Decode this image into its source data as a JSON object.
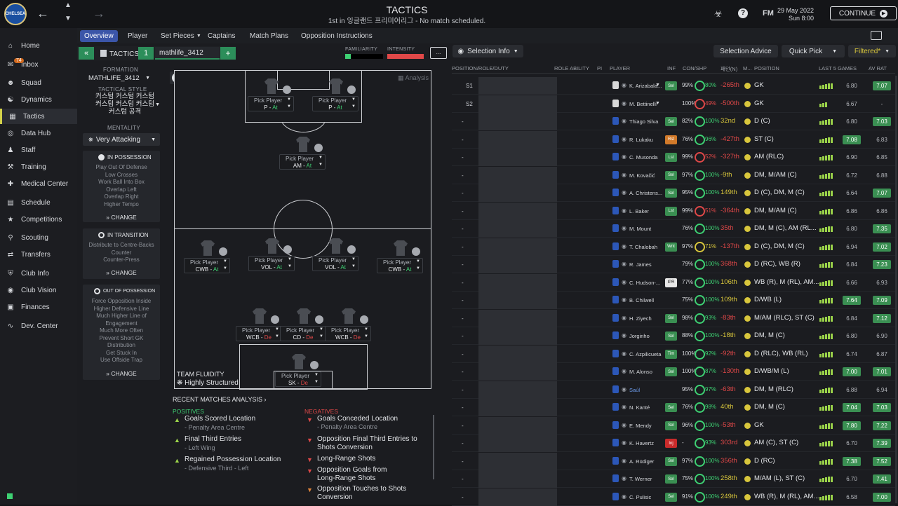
{
  "header": {
    "club_crest": "CHELSEA",
    "title": "TACTICS",
    "subtitle": "1st in 잉글랜드 프리미어리그 - No match scheduled.",
    "date_line1": "29 May 2022",
    "date_line2": "Sun 8:00",
    "continue_label": "CONTINUE",
    "fm_label": "FM"
  },
  "sidebar": {
    "inbox_badge": "74",
    "items": [
      "Home",
      "Inbox",
      "Squad",
      "Dynamics",
      "Tactics",
      "Data Hub",
      "Staff",
      "Training",
      "Medical Center",
      "Schedule",
      "Competitions",
      "Scouting",
      "Transfers",
      "Club Info",
      "Club Vision",
      "Finances",
      "Dev. Center"
    ]
  },
  "subnav": [
    "Overview",
    "Player",
    "Set Pieces",
    "Captains",
    "Match Plans",
    "Opposition Instructions"
  ],
  "tactics": {
    "panel_label": "TACTICS",
    "slot_number": "1",
    "tactic_name": "mathlife_3412",
    "familiarity_label": "FAMILIARITY",
    "intensity_label": "INTENSITY",
    "formation_label": "FORMATION",
    "formation_value": "MATHLIFE_3412",
    "style_label": "TACTICAL STYLE",
    "style_value": [
      "커스텀 커스텀 커스텀",
      "커스텀 커스텀 커스텀",
      "커스텀 공격"
    ],
    "mentality_label": "MENTALITY",
    "mentality_value": "Very Attacking",
    "in_possession": {
      "title": "IN POSSESSION",
      "lines": [
        "Play Out Of Defense",
        "Low Crosses",
        "Work Ball Into Box",
        "Overlap Left",
        "Overlap Right",
        "Higher Tempo"
      ],
      "change": "CHANGE"
    },
    "in_transition": {
      "title": "IN TRANSITION",
      "lines": [
        "Distribute to Centre-Backs",
        "Counter",
        "Counter-Press"
      ],
      "change": "CHANGE"
    },
    "out_of_possession": {
      "title": "OUT OF POSSESSION",
      "lines": [
        "Force Opposition Inside",
        "Higher Defensive Line",
        "Much Higher Line of",
        "Engagement",
        "Much More Often",
        "Prevent Short GK",
        "Distribution",
        "Get Stuck In",
        "Use Offside Trap"
      ],
      "change": "CHANGE"
    },
    "analysis_label": "Analysis",
    "fluidity_label": "TEAM FLUIDITY",
    "fluidity_value": "Highly Structured",
    "pitch_tiles": [
      {
        "label": "Pick Player",
        "role": "P",
        "duty": "At"
      },
      {
        "label": "Pick Player",
        "role": "P",
        "duty": "At"
      },
      {
        "label": "Pick Player",
        "role": "AM",
        "duty": "At"
      },
      {
        "label": "Pick Player",
        "role": "CWB",
        "duty": "At"
      },
      {
        "label": "Pick Player",
        "role": "VOL",
        "duty": "At"
      },
      {
        "label": "Pick Player",
        "role": "VOL",
        "duty": "At"
      },
      {
        "label": "Pick Player",
        "role": "CWB",
        "duty": "At"
      },
      {
        "label": "Pick Player",
        "role": "WCB",
        "duty": "De"
      },
      {
        "label": "Pick Player",
        "role": "CD",
        "duty": "De"
      },
      {
        "label": "Pick Player",
        "role": "WCB",
        "duty": "De"
      },
      {
        "label": "Pick Player",
        "role": "SK",
        "duty": "De"
      }
    ]
  },
  "analysis": {
    "title": "RECENT MATCHES ANALYSIS",
    "positives_label": "POSITIVES",
    "negatives_label": "NEGATIVES",
    "positives": [
      {
        "main": "Goals Scored Location",
        "sub": "- Penalty Area Centre"
      },
      {
        "main": "Final Third Entries",
        "sub": "- Left Wing"
      },
      {
        "main": "Regained Possession Location",
        "sub": "- Defensive Third - Left"
      }
    ],
    "negatives": [
      {
        "main": "Goals Conceded Location",
        "sub": "- Penalty Area Centre"
      },
      {
        "main": "Opposition Final Third Entries to",
        "sub": "Shots Conversion"
      },
      {
        "main": "Long-Range Shots",
        "sub": ""
      },
      {
        "main": "Opposition Goals from",
        "sub": "Long-Range Shots"
      },
      {
        "main": "Opposition Touches to Shots",
        "sub": "Conversion"
      }
    ]
  },
  "table": {
    "selection_info": "Selection Info",
    "selection_advice": "Selection Advice",
    "quick_pick": "Quick Pick",
    "filtered": "Filtered*",
    "headers": [
      "POSITION/ROLE/DUTY",
      "ROLE ABILITY",
      "PI",
      "PLAYER",
      "INF",
      "CON/SHP",
      "패턴(N)",
      "M...",
      "POSITION",
      "LAST 5 GAMES",
      "AV RAT"
    ],
    "rows": [
      {
        "slot": "S1",
        "name": "K. Arizabala...",
        "inf": "Sel",
        "con": "99%",
        "shp": "80%",
        "shp_color": "#3ed173",
        "rep": "-265th",
        "rep_color": "#e04848",
        "pos": "GK",
        "form": [
          3,
          4,
          5,
          6,
          6
        ],
        "last": "6.80",
        "av": "7.07",
        "avgreen": true
      },
      {
        "slot": "S2",
        "name": "M. Bettinelli",
        "inf": "",
        "con": "100%",
        "shp": "49%",
        "shp_color": "#e04848",
        "rep": "-500th",
        "rep_color": "#e04848",
        "pos": "GK",
        "form": [
          3,
          4,
          5
        ],
        "last": "6.67",
        "av": "-",
        "avgreen": false
      },
      {
        "slot": "-",
        "name": "Thiago Silva",
        "inf": "Sel",
        "con": "82%",
        "shp": "100%",
        "shp_color": "#3ed173",
        "rep": "32nd",
        "rep_color": "#d8c63c",
        "pos": "D (C)",
        "form": [
          3,
          4,
          5,
          6,
          6
        ],
        "last": "6.80",
        "av": "7.03",
        "avgreen": true
      },
      {
        "slot": "-",
        "name": "R. Lukaku",
        "inf": "Rst",
        "con": "76%",
        "shp": "96%",
        "shp_color": "#3ed173",
        "rep": "-427th",
        "rep_color": "#e04848",
        "pos": "ST (C)",
        "form": [
          3,
          4,
          5,
          6,
          6
        ],
        "last": "7.08",
        "av": "6.83",
        "avgreen": false
      },
      {
        "slot": "-",
        "name": "C. Musonda",
        "inf": "Lst",
        "con": "99%",
        "shp": "52%",
        "shp_color": "#e04848",
        "rep": "-327th",
        "rep_color": "#e04848",
        "pos": "AM (RLC)",
        "form": [
          3,
          4,
          5,
          6,
          6
        ],
        "last": "6.90",
        "av": "6.85",
        "avgreen": false
      },
      {
        "slot": "-",
        "name": "M. Kovačić",
        "inf": "Sel",
        "con": "97%",
        "shp": "100%",
        "shp_color": "#3ed173",
        "rep": "-9th",
        "rep_color": "#d8c63c",
        "pos": "DM, M/AM (C)",
        "form": [
          3,
          4,
          5,
          6,
          6
        ],
        "last": "6.72",
        "av": "6.88",
        "avgreen": false
      },
      {
        "slot": "-",
        "name": "A. Christens...",
        "inf": "Sel",
        "con": "95%",
        "shp": "100%",
        "shp_color": "#3ed173",
        "rep": "149th",
        "rep_color": "#d8c63c",
        "pos": "D (C), DM, M (C)",
        "form": [
          3,
          4,
          5,
          6,
          6
        ],
        "last": "6.64",
        "av": "7.07",
        "avgreen": true
      },
      {
        "slot": "-",
        "name": "L. Baker",
        "inf": "Lst",
        "con": "99%",
        "shp": "51%",
        "shp_color": "#e04848",
        "rep": "-364th",
        "rep_color": "#e04848",
        "pos": "DM, M/AM (C)",
        "form": [
          3,
          4,
          5,
          6,
          6
        ],
        "last": "6.86",
        "av": "6.86",
        "avgreen": false
      },
      {
        "slot": "-",
        "name": "M. Mount",
        "inf": "",
        "con": "76%",
        "shp": "100%",
        "shp_color": "#3ed173",
        "rep": "35th",
        "rep_color": "#e04848",
        "pos": "DM, M (C), AM (RL...",
        "form": [
          3,
          4,
          5,
          6,
          6
        ],
        "last": "6.80",
        "av": "7.35",
        "avgreen": true
      },
      {
        "slot": "-",
        "name": "T. Chalobah",
        "inf": "Wnt",
        "con": "97%",
        "shp": "71%",
        "shp_color": "#d8c63c",
        "rep": "-137th",
        "rep_color": "#e04848",
        "pos": "D (C), DM, M (C)",
        "form": [
          3,
          4,
          5,
          6,
          6
        ],
        "last": "6.94",
        "av": "7.02",
        "avgreen": true
      },
      {
        "slot": "-",
        "name": "R. James",
        "inf": "",
        "con": "79%",
        "shp": "100%",
        "shp_color": "#3ed173",
        "rep": "368th",
        "rep_color": "#e04848",
        "pos": "D (RC), WB (R)",
        "form": [
          3,
          4,
          5,
          6,
          6
        ],
        "last": "6.84",
        "av": "7.23",
        "avgreen": true
      },
      {
        "slot": "-",
        "name": "C. Hudson-...",
        "inf": "IPR",
        "con": "77%",
        "shp": "100%",
        "shp_color": "#3ed173",
        "rep": "106th",
        "rep_color": "#d8c63c",
        "pos": "WB (R), M (RL), AM...",
        "form": [
          3,
          4,
          5,
          6,
          6
        ],
        "last": "6.66",
        "av": "6.93",
        "avgreen": false
      },
      {
        "slot": "-",
        "name": "B. Chilwell",
        "inf": "",
        "con": "75%",
        "shp": "100%",
        "shp_color": "#3ed173",
        "rep": "109th",
        "rep_color": "#d8c63c",
        "pos": "D/WB (L)",
        "form": [
          3,
          4,
          5,
          6,
          6
        ],
        "last": "7.64",
        "av": "7.09",
        "avgreen": true
      },
      {
        "slot": "-",
        "name": "H. Ziyech",
        "inf": "Sel",
        "con": "98%",
        "shp": "93%",
        "shp_color": "#3ed173",
        "rep": "-83th",
        "rep_color": "#e04848",
        "pos": "M/AM (RLC), ST (C)",
        "form": [
          3,
          4,
          5,
          6,
          6
        ],
        "last": "6.84",
        "av": "7.12",
        "avgreen": true
      },
      {
        "slot": "-",
        "name": "Jorginho",
        "inf": "Sel",
        "con": "88%",
        "shp": "100%",
        "shp_color": "#3ed173",
        "rep": "-18th",
        "rep_color": "#d8c63c",
        "pos": "DM, M (C)",
        "form": [
          3,
          4,
          5,
          6,
          6
        ],
        "last": "6.80",
        "av": "6.90",
        "avgreen": false
      },
      {
        "slot": "-",
        "name": "C. Azpilicueta",
        "inf": "Tim",
        "con": "100%",
        "shp": "92%",
        "shp_color": "#3ed173",
        "rep": "-92th",
        "rep_color": "#e04848",
        "pos": "D (RLC), WB (RL)",
        "form": [
          3,
          4,
          5,
          6,
          6
        ],
        "last": "6.74",
        "av": "6.87",
        "avgreen": false
      },
      {
        "slot": "-",
        "name": "M. Alonso",
        "inf": "Sel",
        "con": "100%",
        "shp": "87%",
        "shp_color": "#3ed173",
        "rep": "-130th",
        "rep_color": "#e04848",
        "pos": "D/WB/M (L)",
        "form": [
          3,
          4,
          5,
          6,
          6
        ],
        "last": "7.00",
        "av": "7.01",
        "avgreen": true
      },
      {
        "slot": "-",
        "name": "Saúl",
        "inf": "",
        "con": "95%",
        "shp": "97%",
        "shp_color": "#3ed173",
        "rep": "-63th",
        "rep_color": "#e04848",
        "pos": "DM, M (RLC)",
        "form": [
          3,
          4,
          5,
          6,
          6
        ],
        "last": "6.88",
        "av": "6.94",
        "avgreen": false
      },
      {
        "slot": "-",
        "name": "N. Kanté",
        "inf": "Sel",
        "con": "76%",
        "shp": "98%",
        "shp_color": "#3ed173",
        "rep": "40th",
        "rep_color": "#d8c63c",
        "pos": "DM, M (C)",
        "form": [
          3,
          4,
          5,
          6,
          6
        ],
        "last": "7.04",
        "av": "7.03",
        "avgreen": true
      },
      {
        "slot": "-",
        "name": "E. Mendy",
        "inf": "Sel",
        "con": "96%",
        "shp": "100%",
        "shp_color": "#3ed173",
        "rep": "-53th",
        "rep_color": "#e04848",
        "pos": "GK",
        "form": [
          3,
          4,
          5,
          6,
          6
        ],
        "last": "7.80",
        "av": "7.22",
        "avgreen": true
      },
      {
        "slot": "-",
        "name": "K. Havertz",
        "inf": "Inj",
        "con": "-",
        "shp": "93%",
        "shp_color": "#3ed173",
        "rep": "303rd",
        "rep_color": "#e04848",
        "pos": "AM (C), ST (C)",
        "form": [
          3,
          4,
          5,
          6,
          6
        ],
        "last": "6.70",
        "av": "7.39",
        "avgreen": true
      },
      {
        "slot": "-",
        "name": "A. Rüdiger",
        "inf": "Sel",
        "con": "97%",
        "shp": "100%",
        "shp_color": "#3ed173",
        "rep": "356th",
        "rep_color": "#e04848",
        "pos": "D (RC)",
        "form": [
          3,
          4,
          5,
          6,
          6
        ],
        "last": "7.38",
        "av": "7.52",
        "avgreen": true
      },
      {
        "slot": "-",
        "name": "T. Werner",
        "inf": "Sel",
        "con": "75%",
        "shp": "100%",
        "shp_color": "#3ed173",
        "rep": "258th",
        "rep_color": "#d8c63c",
        "pos": "M/AM (L), ST (C)",
        "form": [
          3,
          4,
          5,
          6,
          6
        ],
        "last": "6.70",
        "av": "7.41",
        "avgreen": true
      },
      {
        "slot": "-",
        "name": "C. Pulisic",
        "inf": "Sel",
        "con": "91%",
        "shp": "100%",
        "shp_color": "#3ed173",
        "rep": "249th",
        "rep_color": "#d8c63c",
        "pos": "WB (R), M (RL), AM...",
        "form": [
          3,
          4,
          5,
          6,
          6
        ],
        "last": "6.58",
        "av": "7.00",
        "avgreen": true
      }
    ]
  },
  "colors": {
    "accent": "#3b55a8",
    "green": "#3ed173",
    "red": "#e04848",
    "yellow": "#d8c63c"
  }
}
